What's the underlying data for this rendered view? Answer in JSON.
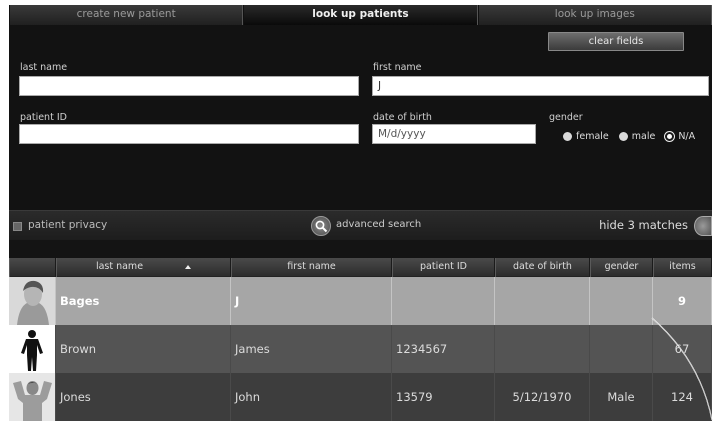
{
  "tabs": [
    "create new patient",
    "look up patients",
    "look up images"
  ],
  "clear_fields": "clear fields",
  "form": {
    "last_name": {
      "label": "last name",
      "value": ""
    },
    "first_name": {
      "label": "first name",
      "value": "J"
    },
    "patient_id": {
      "label": "patient ID",
      "value": ""
    },
    "dob": {
      "label": "date of birth",
      "placeholder": "M/d/yyyy"
    },
    "gender": {
      "label": "gender",
      "options": [
        "female",
        "male",
        "N/A"
      ],
      "selected": "N/A"
    }
  },
  "toolbar": {
    "privacy_label": "patient privacy",
    "advanced_search": "advanced search",
    "hide_matches": "hide 3 matches"
  },
  "table": {
    "headers": [
      "last name",
      "first name",
      "patient ID",
      "date of birth",
      "gender",
      "items"
    ],
    "sorted_column": "last name",
    "rows": [
      {
        "last": "Bages",
        "first": "J",
        "id": "",
        "dob": "",
        "gender": "",
        "items": "9"
      },
      {
        "last": "Brown",
        "first": "James",
        "id": "1234567",
        "dob": "",
        "gender": "",
        "items": "67"
      },
      {
        "last": "Jones",
        "first": "John",
        "id": "13579",
        "dob": "5/12/1970",
        "gender": "Male",
        "items": "124"
      }
    ]
  }
}
